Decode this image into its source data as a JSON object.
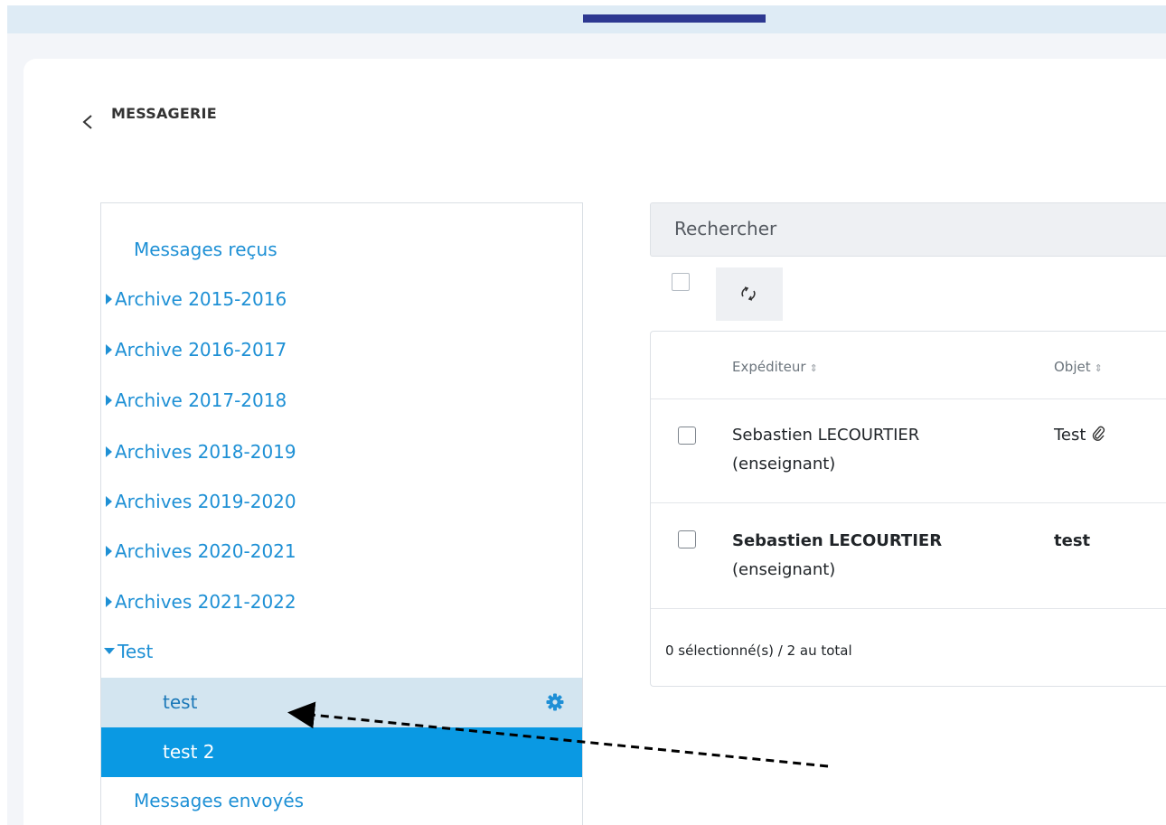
{
  "header": {
    "back_label": "<",
    "title": "MESSAGERIE"
  },
  "sidebar": {
    "inbox": "Messages reçus",
    "folders": [
      "Archive 2015-2016",
      "Archive 2016-2017",
      "Archive 2017-2018",
      "Archives 2018-2019",
      "Archives 2019-2020",
      "Archives 2020-2021",
      "Archives 2021-2022"
    ],
    "expanded_folder": "Test",
    "subfolders": [
      "test",
      "test 2"
    ],
    "sent": "Messages envoyés"
  },
  "search": {
    "placeholder": "Rechercher"
  },
  "table": {
    "columns": {
      "sender": "Expéditeur",
      "subject": "Objet"
    },
    "rows": [
      {
        "sender_line1": "Sebastien LECOURTIER",
        "sender_line2": "(enseignant)",
        "subject": "Test",
        "attachment_icon": "paperclip-icon",
        "unread": false
      },
      {
        "sender_line1": "Sebastien LECOURTIER",
        "sender_line2": "(enseignant)",
        "subject": "test",
        "attachment_icon": "",
        "unread": true
      }
    ],
    "footer": "0 sélectionné(s) / 2 au total"
  },
  "colors": {
    "accent_blue": "#1e90d5",
    "active_bg": "#0a99e3",
    "hover_bg": "#d3e5f0",
    "topbar_accent": "#2d3891"
  }
}
